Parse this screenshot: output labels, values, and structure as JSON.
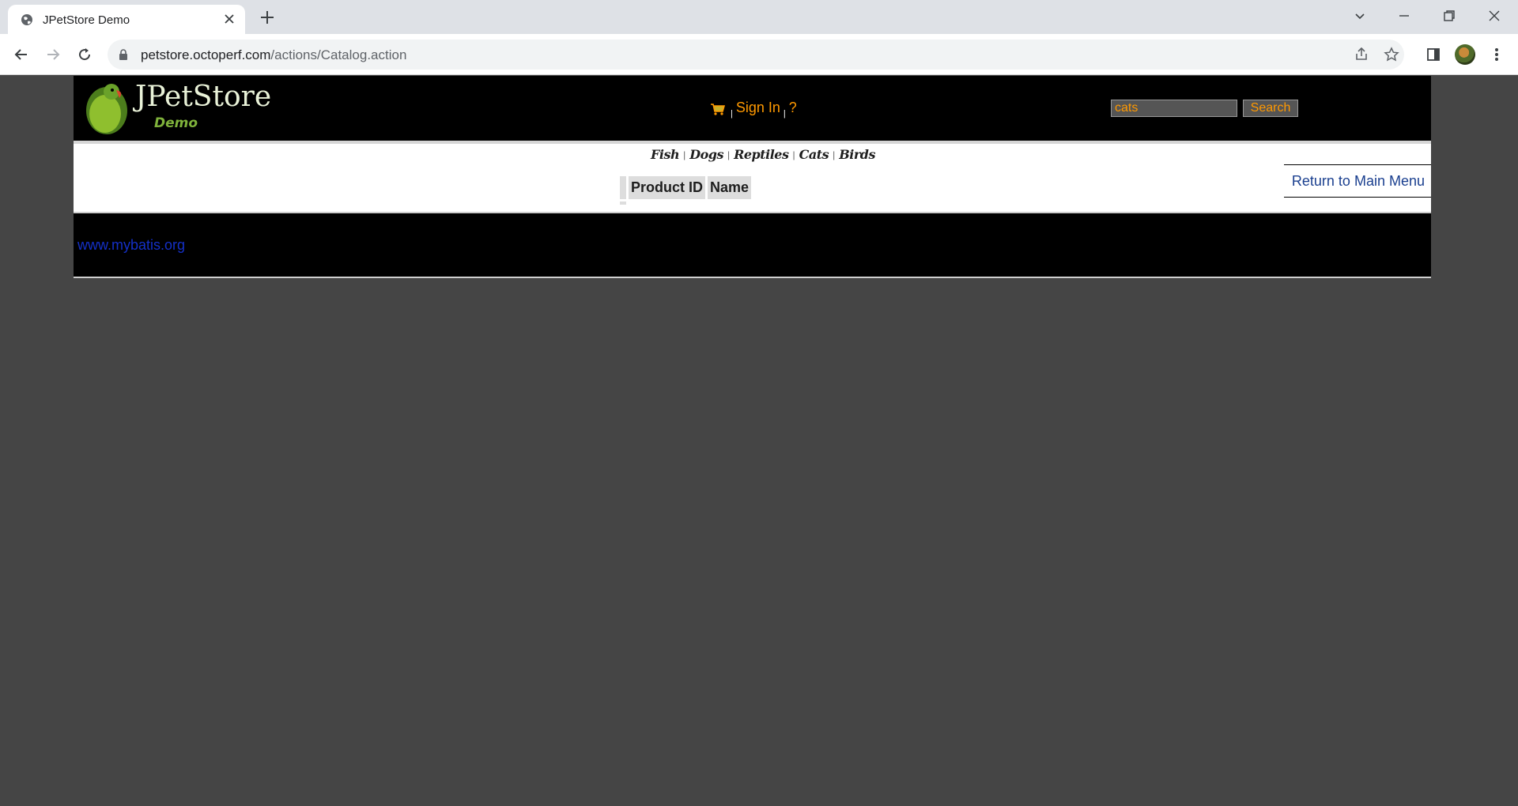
{
  "browser": {
    "tab_title": "JPetStore Demo",
    "url_host": "petstore.octoperf.com",
    "url_path": "/actions/Catalog.action"
  },
  "header": {
    "logo_title": "JPetStore",
    "logo_subtitle": "Demo",
    "sign_in": "Sign In",
    "help": "?",
    "search_value": "cats",
    "search_button": "Search"
  },
  "quicklinks": [
    "Fish",
    "Dogs",
    "Reptiles",
    "Cats",
    "Birds"
  ],
  "results_table": {
    "headers": [
      "Product ID",
      "Name"
    ]
  },
  "return_link": "Return to Main Menu",
  "footer_link": "www.mybatis.org",
  "colors": {
    "menu_accent": "#ff9900",
    "link_blue": "#1a3f8f",
    "page_background": "#454545"
  }
}
